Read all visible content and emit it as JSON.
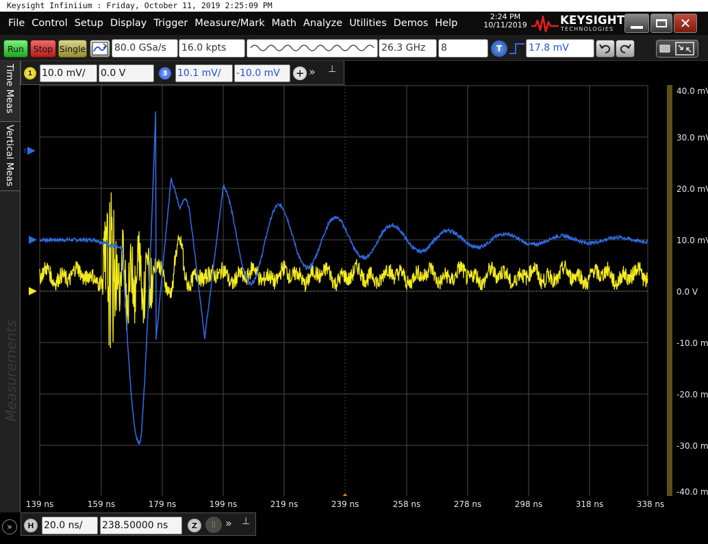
{
  "title_bar": "Keysight Infiniium : Friday, October 11, 2019 2:25:09 PM",
  "menus": [
    "File",
    "Control",
    "Setup",
    "Display",
    "Trigger",
    "Measure/Mark",
    "Math",
    "Analyze",
    "Utilities",
    "Demos",
    "Help"
  ],
  "clock": {
    "time": "2:24 PM",
    "date": "10/11/2019"
  },
  "brand": {
    "name": "KEYSIGHT",
    "sub": "TECHNOLOGIES",
    "color": "#e0201b"
  },
  "toolbar": {
    "run": "Run",
    "stop": "Stop",
    "single": "Single",
    "sample_rate": "80.0 GSa/s",
    "memory_depth": "16.0 kpts",
    "bandwidth": "26.3 GHz",
    "averages": "8",
    "trigger_label": "T",
    "trigger_level": "17.8 mV"
  },
  "channels": [
    {
      "number": "1",
      "scale": "10.0 mV/",
      "offset": "0.0 V",
      "color": "#f5ec1e"
    },
    {
      "number": "3",
      "scale": "10.1 mV/",
      "offset": "-10.0 mV",
      "color": "#2f6ae0"
    }
  ],
  "tabs": {
    "time_meas": "Time Meas",
    "vertical_meas": "Vertical Meas",
    "measurements": "Measurements"
  },
  "y_axis": [
    "40.0 mV",
    "30.0 mV",
    "20.0 mV",
    "10.0 mV",
    "0.0 V",
    "-10.0 mV",
    "-20.0 mV",
    "-30.0 mV",
    "-40.0 mV"
  ],
  "x_axis": [
    "139 ns",
    "159 ns",
    "179 ns",
    "199 ns",
    "219 ns",
    "239 ns",
    "258 ns",
    "278 ns",
    "298 ns",
    "318 ns",
    "338 ns"
  ],
  "horizontal": {
    "label": "H",
    "scale": "20.0 ns/",
    "position": "238.50000 ns",
    "zoom_label": "Z"
  },
  "markers": {
    "trigger": "T"
  },
  "colors": {
    "ch1": "#f5ec1e",
    "ch3": "#2f6ae0",
    "grid": "#4a4a4a",
    "trigger_marker": "#e07a1a"
  }
}
